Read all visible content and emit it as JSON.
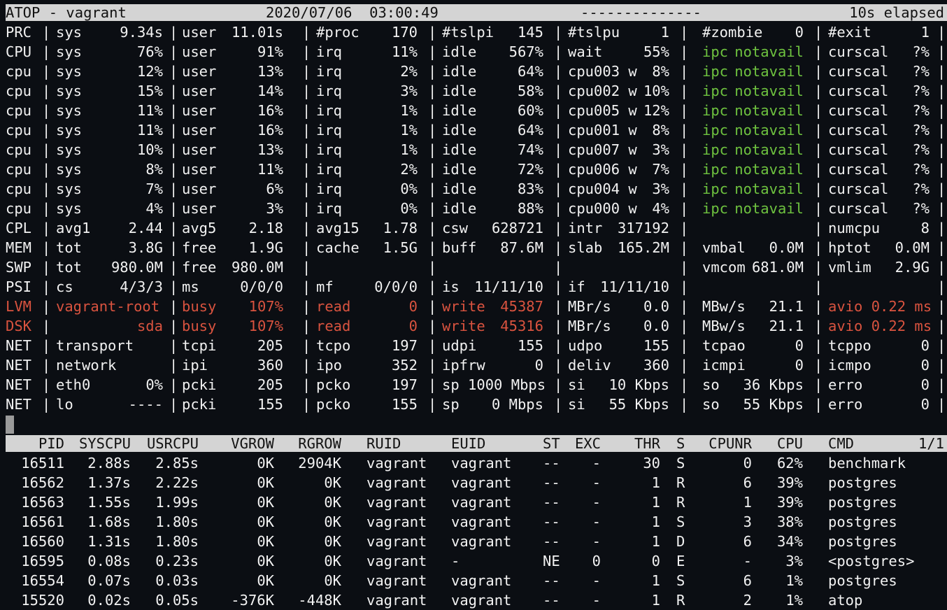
{
  "title": {
    "program": "ATOP - vagrant",
    "datetime": "2020/07/06  03:00:49",
    "dashes": "--------------",
    "elapsed": "10s elapsed"
  },
  "colors": {
    "highlight": "#d9533f",
    "ipc": "#6ec23f",
    "bar": "#d4d4d4"
  },
  "system_rows": [
    {
      "label": "PRC",
      "color": "",
      "c": [
        {
          "k": "sys",
          "v": "9.34s"
        },
        {
          "k": "user",
          "v": "11.01s"
        },
        {
          "k": "#proc",
          "v": "170"
        },
        {
          "k": "#tslpi",
          "v": "145"
        },
        {
          "k": "#tslpu",
          "v": "1"
        },
        {
          "k": "#zombie",
          "v": "0"
        },
        {
          "k": "#exit",
          "v": "1"
        }
      ]
    },
    {
      "label": "CPU",
      "color": "",
      "c": [
        {
          "k": "sys",
          "v": "76%"
        },
        {
          "k": "user",
          "v": "91%"
        },
        {
          "k": "irq",
          "v": "11%"
        },
        {
          "k": "idle",
          "v": "567%"
        },
        {
          "k": "wait",
          "v": "55%"
        },
        {
          "k": "ipc",
          "v": "notavail",
          "cc": "green"
        },
        {
          "k": "curscal",
          "v": "?%"
        }
      ]
    },
    {
      "label": "cpu",
      "color": "",
      "c": [
        {
          "k": "sys",
          "v": "12%"
        },
        {
          "k": "user",
          "v": "13%"
        },
        {
          "k": "irq",
          "v": "2%"
        },
        {
          "k": "idle",
          "v": "64%"
        },
        {
          "k": "cpu003 w",
          "v": "8%"
        },
        {
          "k": "ipc",
          "v": "notavail",
          "cc": "green"
        },
        {
          "k": "curscal",
          "v": "?%"
        }
      ]
    },
    {
      "label": "cpu",
      "color": "",
      "c": [
        {
          "k": "sys",
          "v": "15%"
        },
        {
          "k": "user",
          "v": "14%"
        },
        {
          "k": "irq",
          "v": "3%"
        },
        {
          "k": "idle",
          "v": "58%"
        },
        {
          "k": "cpu002 w",
          "v": "10%"
        },
        {
          "k": "ipc",
          "v": "notavail",
          "cc": "green"
        },
        {
          "k": "curscal",
          "v": "?%"
        }
      ]
    },
    {
      "label": "cpu",
      "color": "",
      "c": [
        {
          "k": "sys",
          "v": "11%"
        },
        {
          "k": "user",
          "v": "16%"
        },
        {
          "k": "irq",
          "v": "1%"
        },
        {
          "k": "idle",
          "v": "60%"
        },
        {
          "k": "cpu005 w",
          "v": "12%"
        },
        {
          "k": "ipc",
          "v": "notavail",
          "cc": "green"
        },
        {
          "k": "curscal",
          "v": "?%"
        }
      ]
    },
    {
      "label": "cpu",
      "color": "",
      "c": [
        {
          "k": "sys",
          "v": "11%"
        },
        {
          "k": "user",
          "v": "16%"
        },
        {
          "k": "irq",
          "v": "1%"
        },
        {
          "k": "idle",
          "v": "64%"
        },
        {
          "k": "cpu001 w",
          "v": "8%"
        },
        {
          "k": "ipc",
          "v": "notavail",
          "cc": "green"
        },
        {
          "k": "curscal",
          "v": "?%"
        }
      ]
    },
    {
      "label": "cpu",
      "color": "",
      "c": [
        {
          "k": "sys",
          "v": "10%"
        },
        {
          "k": "user",
          "v": "13%"
        },
        {
          "k": "irq",
          "v": "1%"
        },
        {
          "k": "idle",
          "v": "74%"
        },
        {
          "k": "cpu007 w",
          "v": "3%"
        },
        {
          "k": "ipc",
          "v": "notavail",
          "cc": "green"
        },
        {
          "k": "curscal",
          "v": "?%"
        }
      ]
    },
    {
      "label": "cpu",
      "color": "",
      "c": [
        {
          "k": "sys",
          "v": "8%"
        },
        {
          "k": "user",
          "v": "11%"
        },
        {
          "k": "irq",
          "v": "2%"
        },
        {
          "k": "idle",
          "v": "72%"
        },
        {
          "k": "cpu006 w",
          "v": "7%"
        },
        {
          "k": "ipc",
          "v": "notavail",
          "cc": "green"
        },
        {
          "k": "curscal",
          "v": "?%"
        }
      ]
    },
    {
      "label": "cpu",
      "color": "",
      "c": [
        {
          "k": "sys",
          "v": "7%"
        },
        {
          "k": "user",
          "v": "6%"
        },
        {
          "k": "irq",
          "v": "0%"
        },
        {
          "k": "idle",
          "v": "83%"
        },
        {
          "k": "cpu004 w",
          "v": "3%"
        },
        {
          "k": "ipc",
          "v": "notavail",
          "cc": "green"
        },
        {
          "k": "curscal",
          "v": "?%"
        }
      ]
    },
    {
      "label": "cpu",
      "color": "",
      "c": [
        {
          "k": "sys",
          "v": "4%"
        },
        {
          "k": "user",
          "v": "3%"
        },
        {
          "k": "irq",
          "v": "0%"
        },
        {
          "k": "idle",
          "v": "88%"
        },
        {
          "k": "cpu000 w",
          "v": "4%"
        },
        {
          "k": "ipc",
          "v": "notavail",
          "cc": "green"
        },
        {
          "k": "curscal",
          "v": "?%"
        }
      ]
    },
    {
      "label": "CPL",
      "color": "",
      "c": [
        {
          "k": "avg1",
          "v": "2.44"
        },
        {
          "k": "avg5",
          "v": "2.18"
        },
        {
          "k": "avg15",
          "v": "1.78"
        },
        {
          "k": "csw",
          "v": "628721"
        },
        {
          "k": "intr",
          "v": "317192"
        },
        {
          "k": "",
          "v": ""
        },
        {
          "k": "numcpu",
          "v": "8"
        }
      ]
    },
    {
      "label": "MEM",
      "color": "",
      "c": [
        {
          "k": "tot",
          "v": "3.8G"
        },
        {
          "k": "free",
          "v": "1.9G"
        },
        {
          "k": "cache",
          "v": "1.5G"
        },
        {
          "k": "buff",
          "v": "87.6M"
        },
        {
          "k": "slab",
          "v": "165.2M"
        },
        {
          "k": "vmbal",
          "v": "0.0M"
        },
        {
          "k": "hptot",
          "v": "0.0M"
        }
      ]
    },
    {
      "label": "SWP",
      "color": "",
      "c": [
        {
          "k": "tot",
          "v": "980.0M"
        },
        {
          "k": "free",
          "v": "980.0M"
        },
        {
          "k": "",
          "v": ""
        },
        {
          "k": "",
          "v": ""
        },
        {
          "k": "",
          "v": ""
        },
        {
          "k": "vmcom",
          "v": "681.0M"
        },
        {
          "k": "vmlim",
          "v": "2.9G"
        }
      ]
    },
    {
      "label": "PSI",
      "color": "",
      "c": [
        {
          "k": "cs",
          "v": "4/3/3"
        },
        {
          "k": "ms",
          "v": "0/0/0"
        },
        {
          "k": "mf",
          "v": "0/0/0"
        },
        {
          "k": "is",
          "v": "11/11/10"
        },
        {
          "k": "if",
          "v": "11/11/10"
        },
        {
          "k": "",
          "v": ""
        },
        {
          "k": "",
          "v": ""
        }
      ]
    },
    {
      "label": "LVM",
      "color": "red",
      "c": [
        {
          "k": "vagrant-root",
          "v": "",
          "cc": "red"
        },
        {
          "k": "busy",
          "v": "107%",
          "cc": "red"
        },
        {
          "k": "read",
          "v": "0",
          "cc": "red"
        },
        {
          "k": "write",
          "v": "45387",
          "cc": "red"
        },
        {
          "k": "MBr/s",
          "v": "0.0"
        },
        {
          "k": "MBw/s",
          "v": "21.1"
        },
        {
          "k": "avio 0.22 ms",
          "v": "",
          "cc": "red"
        }
      ]
    },
    {
      "label": "DSK",
      "color": "red",
      "c": [
        {
          "k": "",
          "v": "sda",
          "cc": "red"
        },
        {
          "k": "busy",
          "v": "107%",
          "cc": "red"
        },
        {
          "k": "read",
          "v": "0",
          "cc": "red"
        },
        {
          "k": "write",
          "v": "45316",
          "cc": "red"
        },
        {
          "k": "MBr/s",
          "v": "0.0"
        },
        {
          "k": "MBw/s",
          "v": "21.1"
        },
        {
          "k": "avio 0.22 ms",
          "v": "",
          "cc": "red"
        }
      ]
    },
    {
      "label": "NET",
      "color": "",
      "c": [
        {
          "k": "transport",
          "v": ""
        },
        {
          "k": "tcpi",
          "v": "205"
        },
        {
          "k": "tcpo",
          "v": "197"
        },
        {
          "k": "udpi",
          "v": "155"
        },
        {
          "k": "udpo",
          "v": "155"
        },
        {
          "k": "tcpao",
          "v": "0"
        },
        {
          "k": "tcppo",
          "v": "0"
        }
      ]
    },
    {
      "label": "NET",
      "color": "",
      "c": [
        {
          "k": "network",
          "v": ""
        },
        {
          "k": "ipi",
          "v": "360"
        },
        {
          "k": "ipo",
          "v": "352"
        },
        {
          "k": "ipfrw",
          "v": "0"
        },
        {
          "k": "deliv",
          "v": "360"
        },
        {
          "k": "icmpi",
          "v": "0"
        },
        {
          "k": "icmpo",
          "v": "0"
        }
      ]
    },
    {
      "label": "NET",
      "color": "",
      "c": [
        {
          "k": "eth0",
          "v": "0%"
        },
        {
          "k": "pcki",
          "v": "205"
        },
        {
          "k": "pcko",
          "v": "197"
        },
        {
          "k": "sp 1000 Mbps",
          "v": ""
        },
        {
          "k": "si",
          "v": "10 Kbps"
        },
        {
          "k": "so",
          "v": "36 Kbps"
        },
        {
          "k": "erro",
          "v": "0"
        }
      ]
    },
    {
      "label": "NET",
      "color": "",
      "c": [
        {
          "k": "lo",
          "v": "----"
        },
        {
          "k": "pcki",
          "v": "155"
        },
        {
          "k": "pcko",
          "v": "155"
        },
        {
          "k": "sp",
          "v": "0 Mbps"
        },
        {
          "k": "si",
          "v": "55 Kbps"
        },
        {
          "k": "so",
          "v": "55 Kbps"
        },
        {
          "k": "erro",
          "v": "0"
        }
      ]
    }
  ],
  "process_header": [
    "PID",
    "SYSCPU",
    "USRCPU",
    "VGROW",
    "RGROW",
    "RUID",
    "EUID",
    "ST",
    "EXC",
    "THR",
    "S",
    "CPUNR",
    "CPU",
    "CMD",
    "1/1"
  ],
  "processes": [
    [
      "16511",
      "2.88s",
      "2.85s",
      "0K",
      "2904K",
      "vagrant",
      "vagrant",
      "--",
      "-",
      "30",
      "S",
      "0",
      "62%",
      "benchmark"
    ],
    [
      "16562",
      "1.37s",
      "2.22s",
      "0K",
      "0K",
      "vagrant",
      "vagrant",
      "--",
      "-",
      "1",
      "R",
      "6",
      "39%",
      "postgres"
    ],
    [
      "16563",
      "1.55s",
      "1.99s",
      "0K",
      "0K",
      "vagrant",
      "vagrant",
      "--",
      "-",
      "1",
      "R",
      "1",
      "39%",
      "postgres"
    ],
    [
      "16561",
      "1.68s",
      "1.80s",
      "0K",
      "0K",
      "vagrant",
      "vagrant",
      "--",
      "-",
      "1",
      "S",
      "3",
      "38%",
      "postgres"
    ],
    [
      "16560",
      "1.31s",
      "1.80s",
      "0K",
      "0K",
      "vagrant",
      "vagrant",
      "--",
      "-",
      "1",
      "D",
      "6",
      "34%",
      "postgres"
    ],
    [
      "16595",
      "0.08s",
      "0.23s",
      "0K",
      "0K",
      "vagrant",
      "-",
      "NE",
      "0",
      "0",
      "E",
      "-",
      "3%",
      "<postgres>"
    ],
    [
      "16554",
      "0.07s",
      "0.03s",
      "0K",
      "0K",
      "vagrant",
      "vagrant",
      "--",
      "-",
      "1",
      "S",
      "6",
      "1%",
      "postgres"
    ],
    [
      "15520",
      "0.02s",
      "0.05s",
      "-376K",
      "-448K",
      "vagrant",
      "vagrant",
      "--",
      "-",
      "1",
      "R",
      "2",
      "1%",
      "atop"
    ]
  ]
}
